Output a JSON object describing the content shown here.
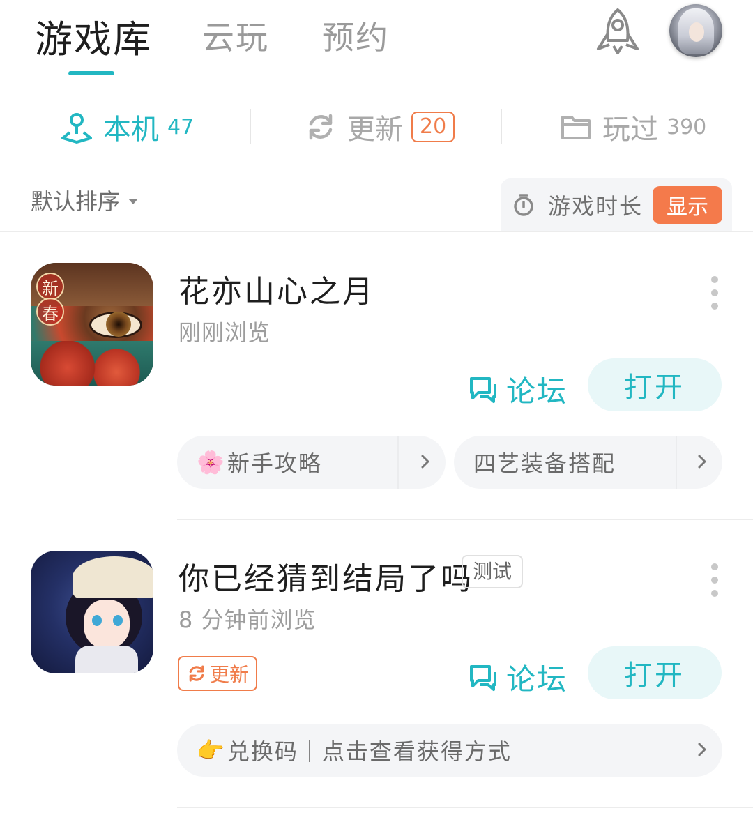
{
  "top_tabs": [
    "游戏库",
    "云玩",
    "预约"
  ],
  "sub_tabs": {
    "local": {
      "label": "本机",
      "count": "47"
    },
    "update": {
      "label": "更新",
      "count": "20"
    },
    "played": {
      "label": "玩过",
      "count": "390"
    }
  },
  "sort": {
    "label": "默认排序"
  },
  "playtime": {
    "label": "游戏时长",
    "button": "显示"
  },
  "games": [
    {
      "name": "花亦山心之月",
      "subtitle": "刚刚浏览",
      "badge_chars": [
        "新",
        "春"
      ],
      "forum_label": "论坛",
      "open_label": "打开",
      "links": [
        "新手攻略",
        "四艺装备搭配"
      ],
      "link_emoji": "🌸"
    },
    {
      "name": "你已经猜到结局了吗",
      "tag": "测试",
      "subtitle": "8 分钟前浏览",
      "update_label": "更新",
      "forum_label": "论坛",
      "open_label": "打开",
      "links": [
        "兑换码｜点击查看获得方式"
      ],
      "link_emoji": "👉"
    }
  ],
  "colors": {
    "accent": "#22b7c2",
    "orange": "#f07c4a",
    "show_button": "#f47a4b"
  },
  "icons": [
    "rocket-icon",
    "location-person-icon",
    "refresh-icon",
    "folder-icon",
    "stopwatch-icon",
    "chat-bubbles-icon",
    "chevron-right-icon",
    "more-vertical-icon"
  ]
}
